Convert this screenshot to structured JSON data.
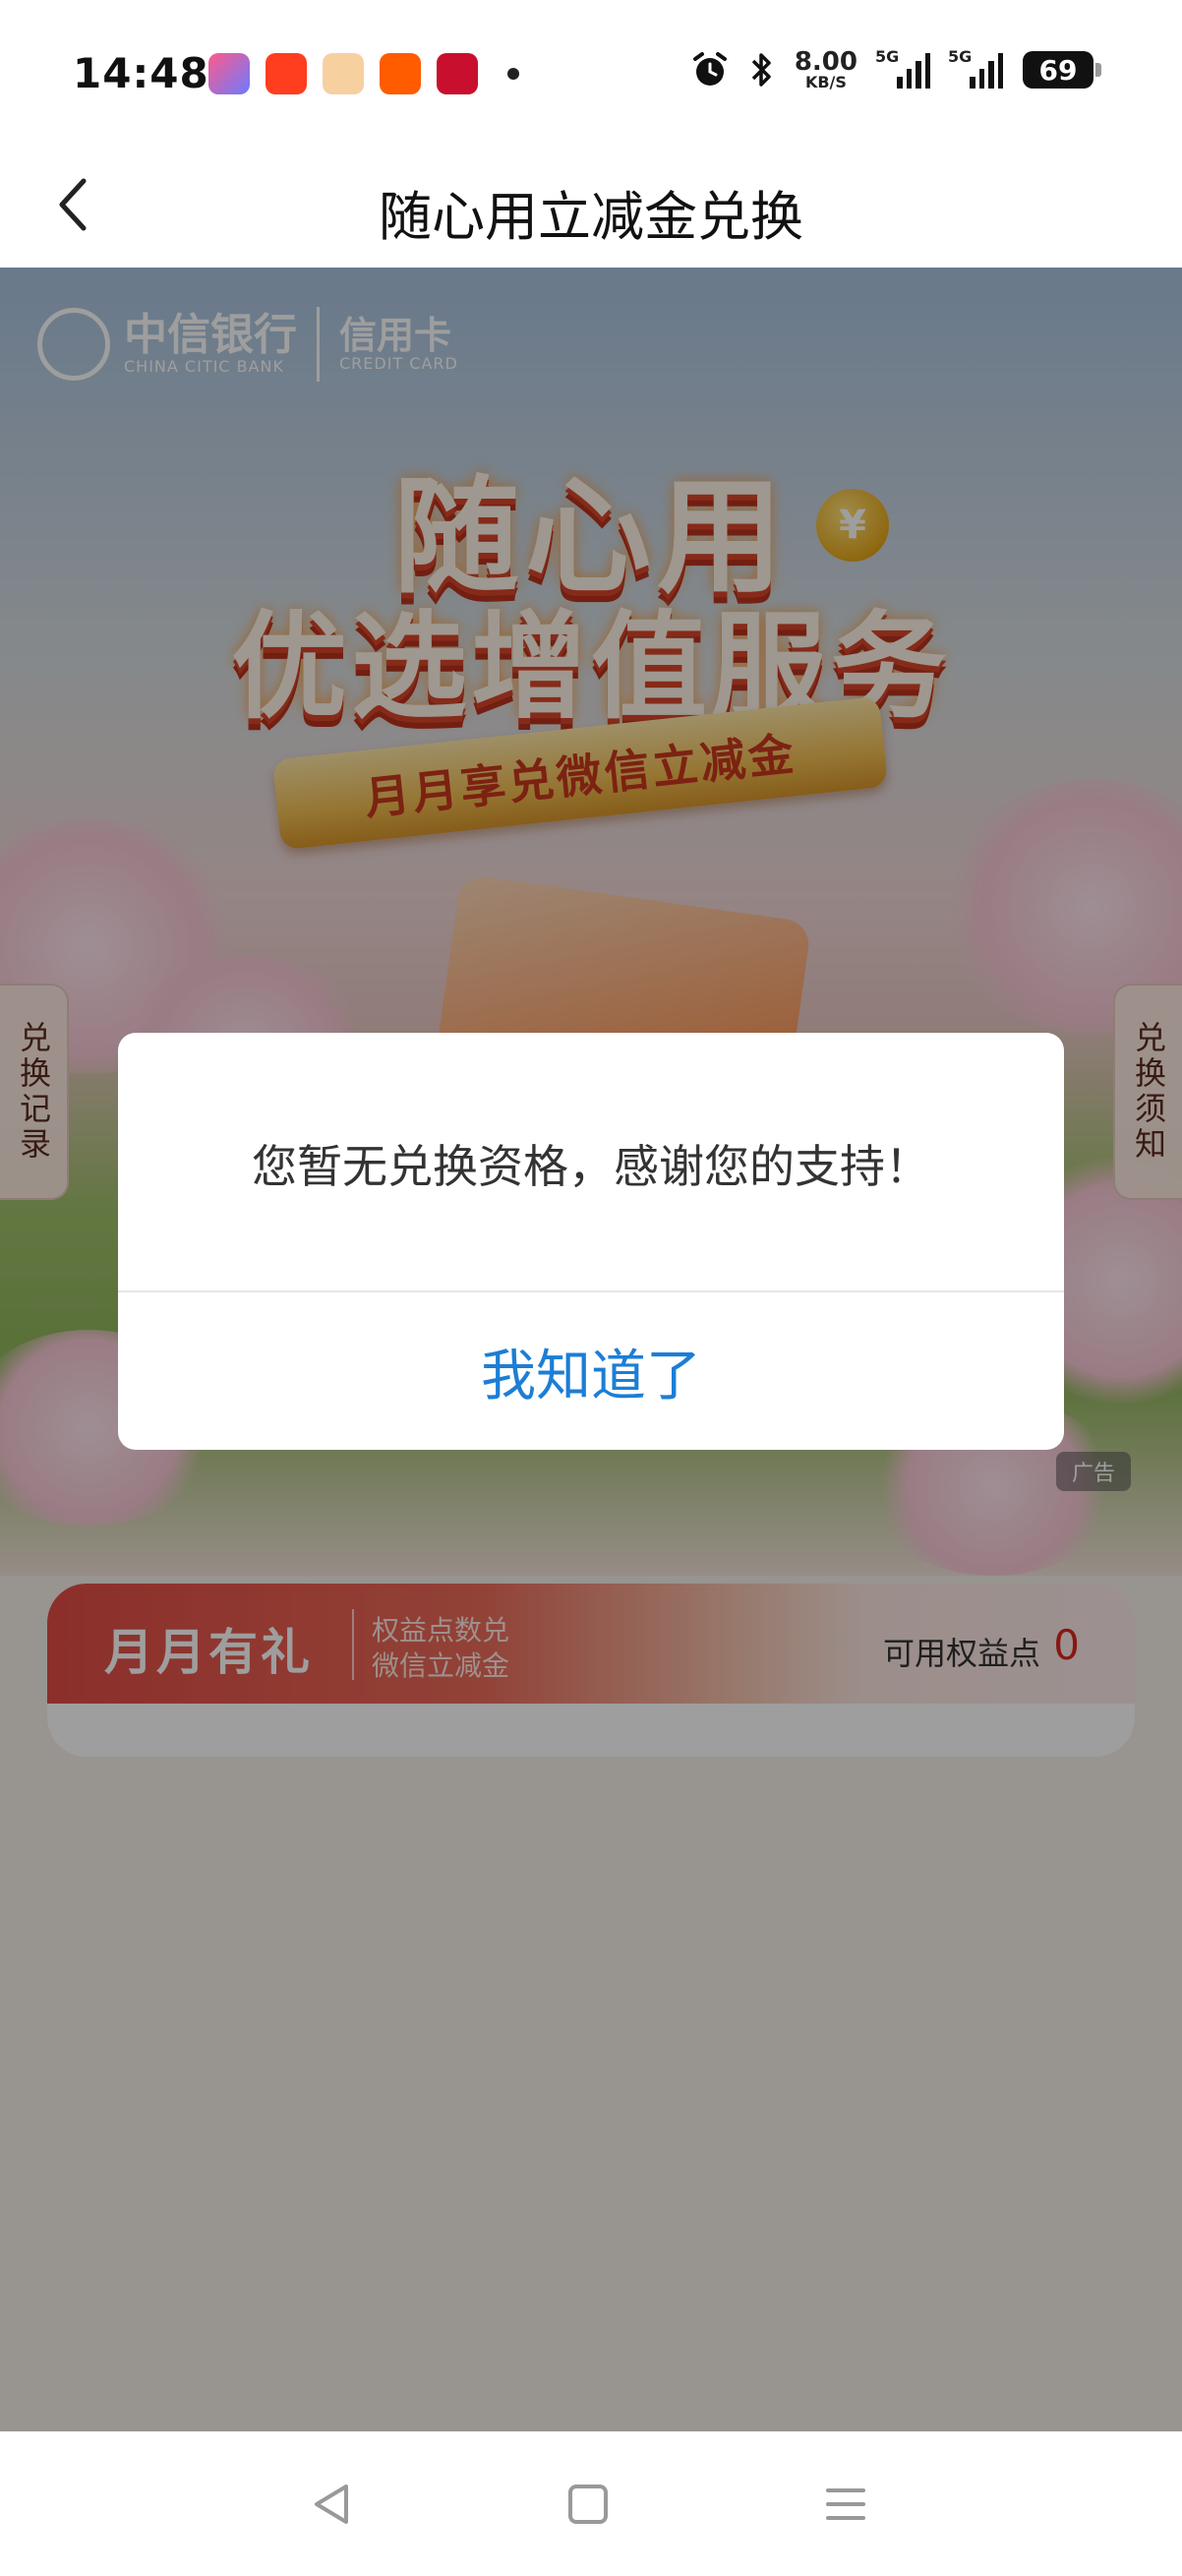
{
  "status_bar": {
    "time": "14:48",
    "net_speed_value": "8.00",
    "net_speed_unit": "KB/S",
    "signal1_label": "5G",
    "signal2_label": "5G",
    "battery": "69",
    "app_icons": [
      "pinduoduo-618-icon",
      "taobao-orange-icon",
      "meituan-icon",
      "taobao-icon",
      "bank-app-icon"
    ]
  },
  "nav": {
    "title": "随心用立减金兑换"
  },
  "banner": {
    "bank_name_cn": "中信银行",
    "bank_name_en": "CHINA CITIC BANK",
    "card_cn": "信用卡",
    "card_en": "CREDIT CARD",
    "headline_line1": "随心用",
    "headline_line2": "优选增值服务",
    "ribbon_text": "月月享兑微信立减金",
    "coin_symbol": "¥",
    "ad_label": "广告"
  },
  "side_tabs": {
    "left": "兑换记录",
    "right": "兑换须知"
  },
  "points_card": {
    "title": "月月有礼",
    "subtitle_line1": "权益点数兑",
    "subtitle_line2": "微信立减金",
    "points_label": "可用权益点",
    "points_value": "0"
  },
  "dialog": {
    "message": "您暂无兑换资格，感谢您的支持！",
    "confirm_label": "我知道了"
  }
}
